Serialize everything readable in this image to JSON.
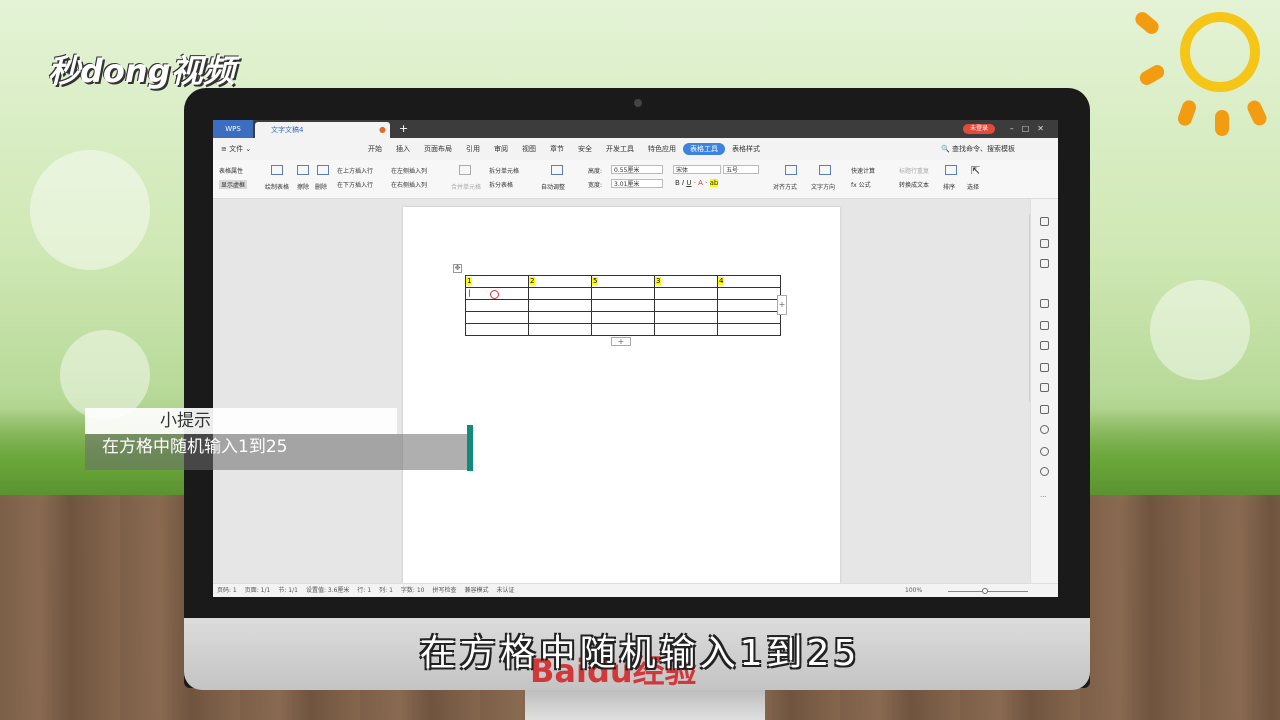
{
  "brand_logo": "秒dong视频",
  "window": {
    "app_label": "WPS",
    "doc_tab": "文字文稿4",
    "login_label": "未登录"
  },
  "menubar": {
    "file": "≡ 文件 ⌄",
    "items": [
      "开始",
      "插入",
      "页面布局",
      "引用",
      "审阅",
      "视图",
      "章节",
      "安全",
      "开发工具",
      "特色应用",
      "表格工具",
      "表格样式"
    ],
    "active_index": 10,
    "search": "查找命令、搜索模板"
  },
  "ribbon": {
    "table_props": "表格属性",
    "show_gridlines": "显示虚框",
    "draw_table": "绘制表格",
    "erase": "擦除",
    "delete": "删除",
    "insert_above": "在上方插入行",
    "insert_below": "在下方插入行",
    "insert_left": "在左侧插入列",
    "insert_right": "在右侧插入列",
    "merge_cells": "合并单元格",
    "split_cells": "拆分单元格",
    "split_table": "拆分表格",
    "auto_fit": "自动调整",
    "height_label": "高度:",
    "height_value": "0.55厘米",
    "width_label": "宽度:",
    "width_value": "3.01厘米",
    "font_name": "宋体",
    "font_size": "五号",
    "align": "对齐方式",
    "text_dir": "文字方向",
    "quick_calc": "快速计算",
    "title_repeat": "标题行重复",
    "formula": "fx 公式",
    "to_text": "转换成文本",
    "sort": "排序",
    "select": "选择"
  },
  "table": {
    "rows": [
      [
        "1",
        "2",
        "5",
        "3",
        "4"
      ],
      [
        "",
        "",
        "",
        "",
        ""
      ],
      [
        "",
        "",
        "",
        "",
        ""
      ],
      [
        "",
        "",
        "",
        "",
        ""
      ],
      [
        "",
        "",
        "",
        "",
        ""
      ]
    ]
  },
  "statusbar": {
    "items": [
      "页码: 1",
      "页面: 1/1",
      "节: 1/1",
      "设置值: 3.6厘米",
      "行: 1",
      "列: 1",
      "字数: 10",
      "拼写检查",
      "兼容模式",
      "未认证"
    ],
    "zoom": "100%"
  },
  "tip": {
    "heading": "小提示",
    "body": "在方格中随机输入1到25"
  },
  "subtitle": "在方格中随机输入1到25",
  "watermark": "Baidu经验",
  "colors": {
    "accent_blue": "#3c82e0",
    "tip_bar": "#138a7e",
    "highlight": "#ffff00",
    "login_red": "#e24b3b"
  }
}
